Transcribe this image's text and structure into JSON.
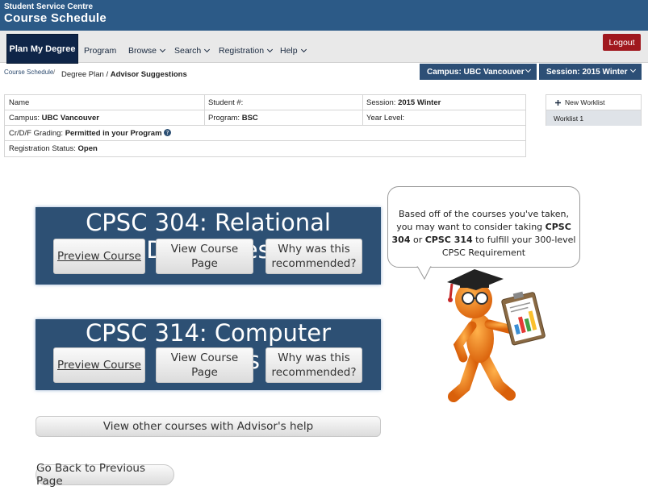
{
  "header": {
    "org": "Student Service Centre",
    "title": "Course Schedule"
  },
  "nav": {
    "plan_label": "Plan My Degree",
    "items": [
      "Program",
      "Browse",
      "Search",
      "Registration",
      "Help"
    ],
    "logout_label": "Logout"
  },
  "breadcrumb": {
    "home": "Course Schedule",
    "sep": "/",
    "path": "Degree Plan / ",
    "current": "Advisor Suggestions"
  },
  "selectors": {
    "campus": "Campus: UBC Vancouver",
    "session": "Session: 2015 Winter"
  },
  "student": {
    "name_label": "Name",
    "student_no_label": "Student #:",
    "session_label": "Session:",
    "session_value": "2015 Winter",
    "campus_label": "Campus:",
    "campus_value": "UBC Vancouver",
    "program_label": "Program:",
    "program_value": "BSC",
    "year_label": "Year Level:",
    "grading_label": "Cr/D/F Grading:",
    "grading_value": "Permitted in your Program",
    "reg_label": "Registration Status:",
    "reg_value": "Open"
  },
  "worklist": {
    "new_label": "New Worklist",
    "items": [
      "Worklist 1"
    ]
  },
  "courses": [
    {
      "title": "CPSC 304: Relational Databases",
      "preview": "Preview Course",
      "view": "View Course Page",
      "why_line1": "Why was this",
      "why_line2": "recommended?"
    },
    {
      "title": "CPSC 314: Computer Graphics",
      "preview": "Preview Course",
      "view": "View Course Page",
      "why_line1": "Why was this",
      "why_line2": "recommended?"
    }
  ],
  "advisor_button": "View other courses with Advisor's help",
  "back_button": "Go Back to Previous Page",
  "bubble": {
    "part1": "Based off of the courses you've taken, you may want to consider taking ",
    "c1": "CPSC 304",
    "part2": " or ",
    "c2": "CPSC 314",
    "part3": " to fulfill your 300-level CPSC Requirement"
  },
  "colors": {
    "header": "#2c5a87",
    "card": "#2d5074",
    "logout": "#a0181e",
    "mascot": "#e8730a"
  }
}
